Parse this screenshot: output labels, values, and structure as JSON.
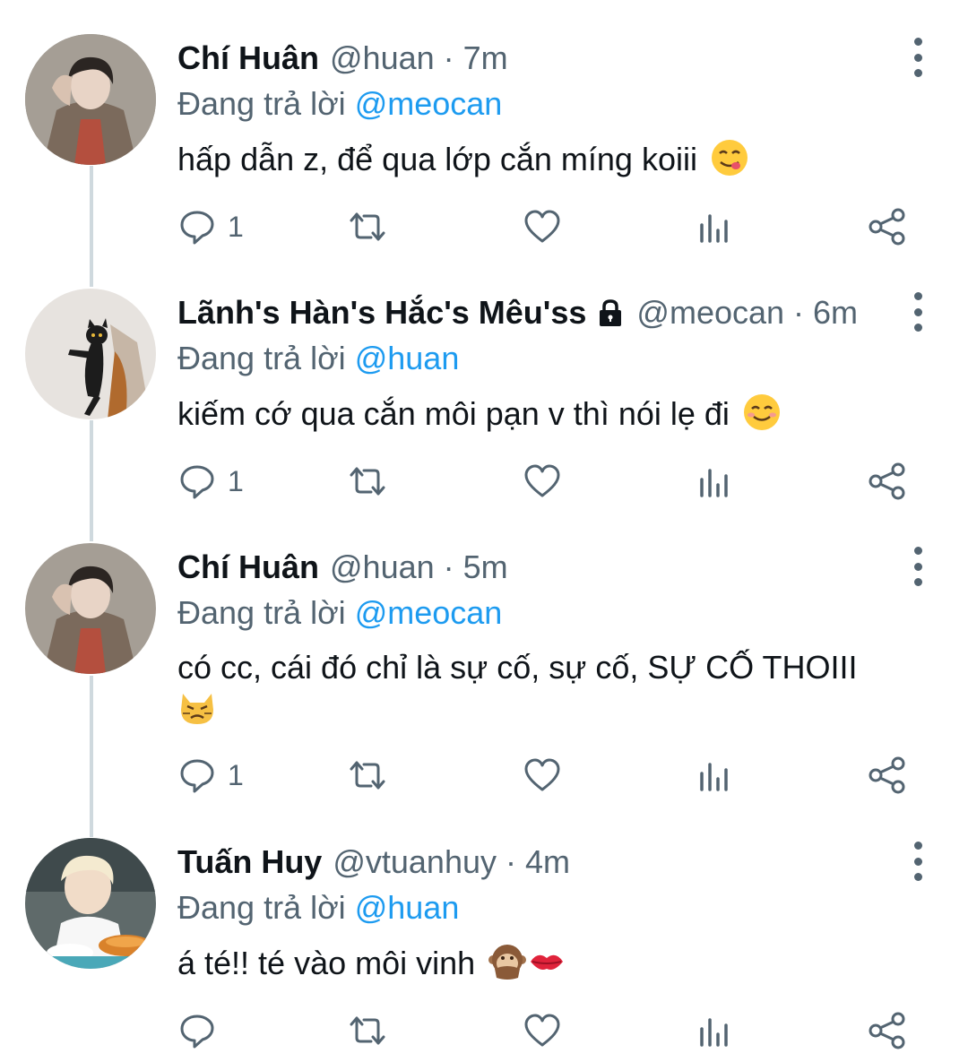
{
  "reply_prefix": "Đang trả lời",
  "tweets": [
    {
      "name": "Chí Huân",
      "handle": "@huan",
      "time": "7m",
      "reply_to": "@meocan",
      "text": "hấp dẫn z, để qua lớp cắn míng koiii",
      "emoji": "yum-face-emoji",
      "reply_count": "1",
      "avatar": "huan-avatar"
    },
    {
      "name": "Lãnh's Hàn's Hắc's Mêu'ss",
      "handle": "@meocan",
      "time": "6m",
      "reply_to": "@huan",
      "text": "kiếm cớ qua cắn môi pạn v thì nói lẹ đi",
      "emoji": "smiling-face-emoji",
      "reply_count": "1",
      "locked": true,
      "avatar": "black-cat-avatar"
    },
    {
      "name": "Chí Huân",
      "handle": "@huan",
      "time": "5m",
      "reply_to": "@meocan",
      "text": "có cc, cái đó chỉ là sự cố, sự cố, SỰ CỐ THOIII",
      "emoji": "pouting-cat-emoji",
      "reply_count": "1",
      "avatar": "huan-avatar"
    },
    {
      "name": "Tuấn Huy",
      "handle": "@vtuanhuy",
      "time": "4m",
      "reply_to": "@huan",
      "text": "á té!! té vào môi vinh",
      "emoji": "speak-no-evil-monkey-and-kiss-mark-emoji",
      "reply_count": "",
      "avatar": "tuanhuy-avatar"
    }
  ],
  "colors": {
    "link": "#1d9bf0",
    "secondary": "#536471",
    "thread_line": "#cfd9de"
  }
}
